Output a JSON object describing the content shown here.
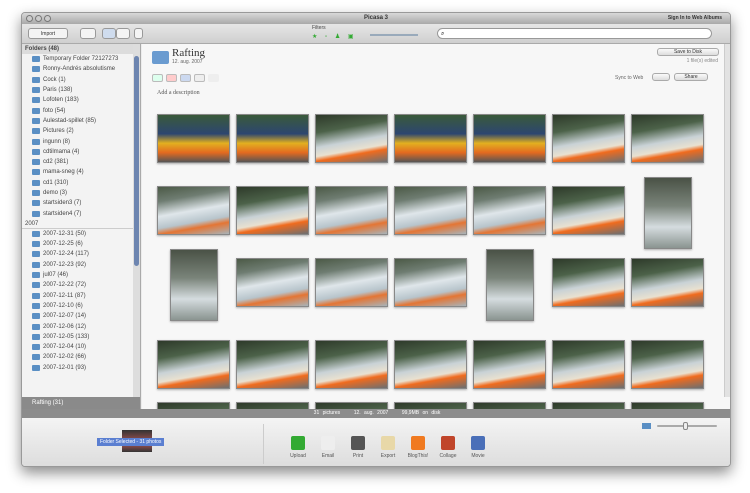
{
  "window": {
    "title": "Picasa 3",
    "sign_in": "Sign In to Web Albums"
  },
  "toolbar": {
    "import": "Import",
    "filters_label": "Filters",
    "search_placeholder": ""
  },
  "sidebar": {
    "folders_header": "Folders (48)",
    "folders": [
      "Temporary Folder 72127273",
      "Ronny-Andrés absolutisme",
      "Cock (1)",
      "Paris (138)",
      "Lofoten (183)",
      "foto (54)",
      "Aulestad-spillet (85)",
      "Pictures (2)",
      "ingunn (8)",
      "cdtilmama (4)",
      "cd2 (381)",
      "mama-sneg (4)",
      "cd1 (310)",
      "demo (3)",
      "startsiden3 (7)",
      "startsiden4 (7)"
    ],
    "year": "2007",
    "dated": [
      "2007-12-31 (50)",
      "2007-12-25 (6)",
      "2007-12-24 (117)",
      "2007-12-23 (92)",
      "jul07 (46)",
      "2007-12-22 (72)",
      "2007-12-11 (87)",
      "2007-12-10 (6)",
      "2007-12-07 (14)",
      "2007-12-06 (12)",
      "2007-12-05 (133)",
      "2007-12-04 (10)",
      "2007-12-02 (66)",
      "2007-12-01 (93)"
    ],
    "selected": "Rafting (31)"
  },
  "album": {
    "title": "Rafting",
    "date": "12. aug. 2007",
    "description_placeholder": "Add a description",
    "save_to_disk": "Save to Disk",
    "edited": "1 file(s) edited",
    "sync_label": "Sync to Web",
    "share": "Share"
  },
  "status": {
    "pictures": "31 pictures",
    "date": "12. aug. 2007",
    "size": "99,9MB on disk"
  },
  "tray": {
    "selection": "Folder Selected - 31 photos",
    "actions": [
      "Upload",
      "Email",
      "Print",
      "Export",
      "BlogThis!",
      "Collage",
      "Movie"
    ]
  },
  "colors": {
    "accent": "#5b7fd1",
    "folder": "#5a8fc4"
  }
}
